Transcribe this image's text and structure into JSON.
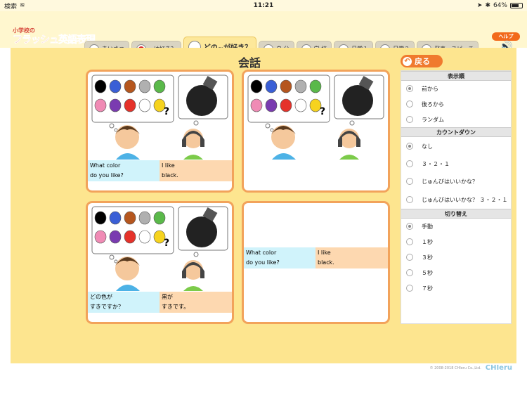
{
  "status": {
    "back_label": "検索",
    "time": "11:21",
    "battery": "64%"
  },
  "app": {
    "logo_line1": "小学校の",
    "logo_line2a": "フラッシュ",
    "logo_line2b": "英語表現"
  },
  "tabs": [
    {
      "label": "あいさつ",
      "icon": "face-icon"
    },
    {
      "label": "~は好き？",
      "icon": "apple-icon"
    },
    {
      "label": "どの~が好き？",
      "icon": "face-icon"
    },
    {
      "label": "自 分",
      "icon": "face-icon"
    },
    {
      "label": "学 校",
      "icon": "school-icon"
    },
    {
      "label": "日常１",
      "icon": "face-icon"
    },
    {
      "label": "日常２",
      "icon": "face-icon"
    },
    {
      "label": "発表・スピーチ",
      "icon": "face-icon"
    }
  ],
  "help": {
    "label": "ヘルプ"
  },
  "page": {
    "title": "会話"
  },
  "cards": [
    {
      "question_lines": [
        "What color",
        "do you like?"
      ],
      "answer_lines": [
        "I like",
        "black."
      ]
    },
    {
      "question_lines": [
        "",
        ""
      ],
      "answer_lines": [
        "",
        ""
      ]
    },
    {
      "question_lines": [
        "どの色が",
        "すきですか？"
      ],
      "answer_lines": [
        "黒が",
        "すきです。"
      ]
    },
    {
      "question_lines": [
        "What color",
        "do you like?"
      ],
      "answer_lines": [
        "I like",
        "black."
      ]
    }
  ],
  "back_button": {
    "label": "戻る"
  },
  "settings": {
    "order": {
      "header": "表示順",
      "options": [
        "前から",
        "後ろから",
        "ランダム"
      ],
      "selected": 0
    },
    "countdown": {
      "header": "カウントダウン",
      "options": [
        "なし",
        "３・２・１",
        "じゅんびはいいかな？",
        "じゅんびはいいかな？ ３・２・１"
      ],
      "selected": 0
    },
    "switch": {
      "header": "切り替え",
      "options": [
        "手動",
        "１秒",
        "３秒",
        "５秒",
        "７秒"
      ],
      "selected": 0
    }
  },
  "footer": {
    "copyright": "© 2008-2018 CHIeru Co.,Ltd.",
    "brand": "CHIeru"
  },
  "colors": {
    "accent": "#f07a2e",
    "background": "#fde58f",
    "card_border": "#f2a35b",
    "question_bg": "#d0f3fb",
    "answer_bg": "#fdd8b0"
  },
  "balloon_colors": [
    "#000000",
    "#3a5fd6",
    "#b5561e",
    "#b0b0b0",
    "#5ab94a",
    "#f08bb5",
    "#7a3bb0",
    "#e5322a",
    "#ffffff",
    "#f6d31e"
  ]
}
